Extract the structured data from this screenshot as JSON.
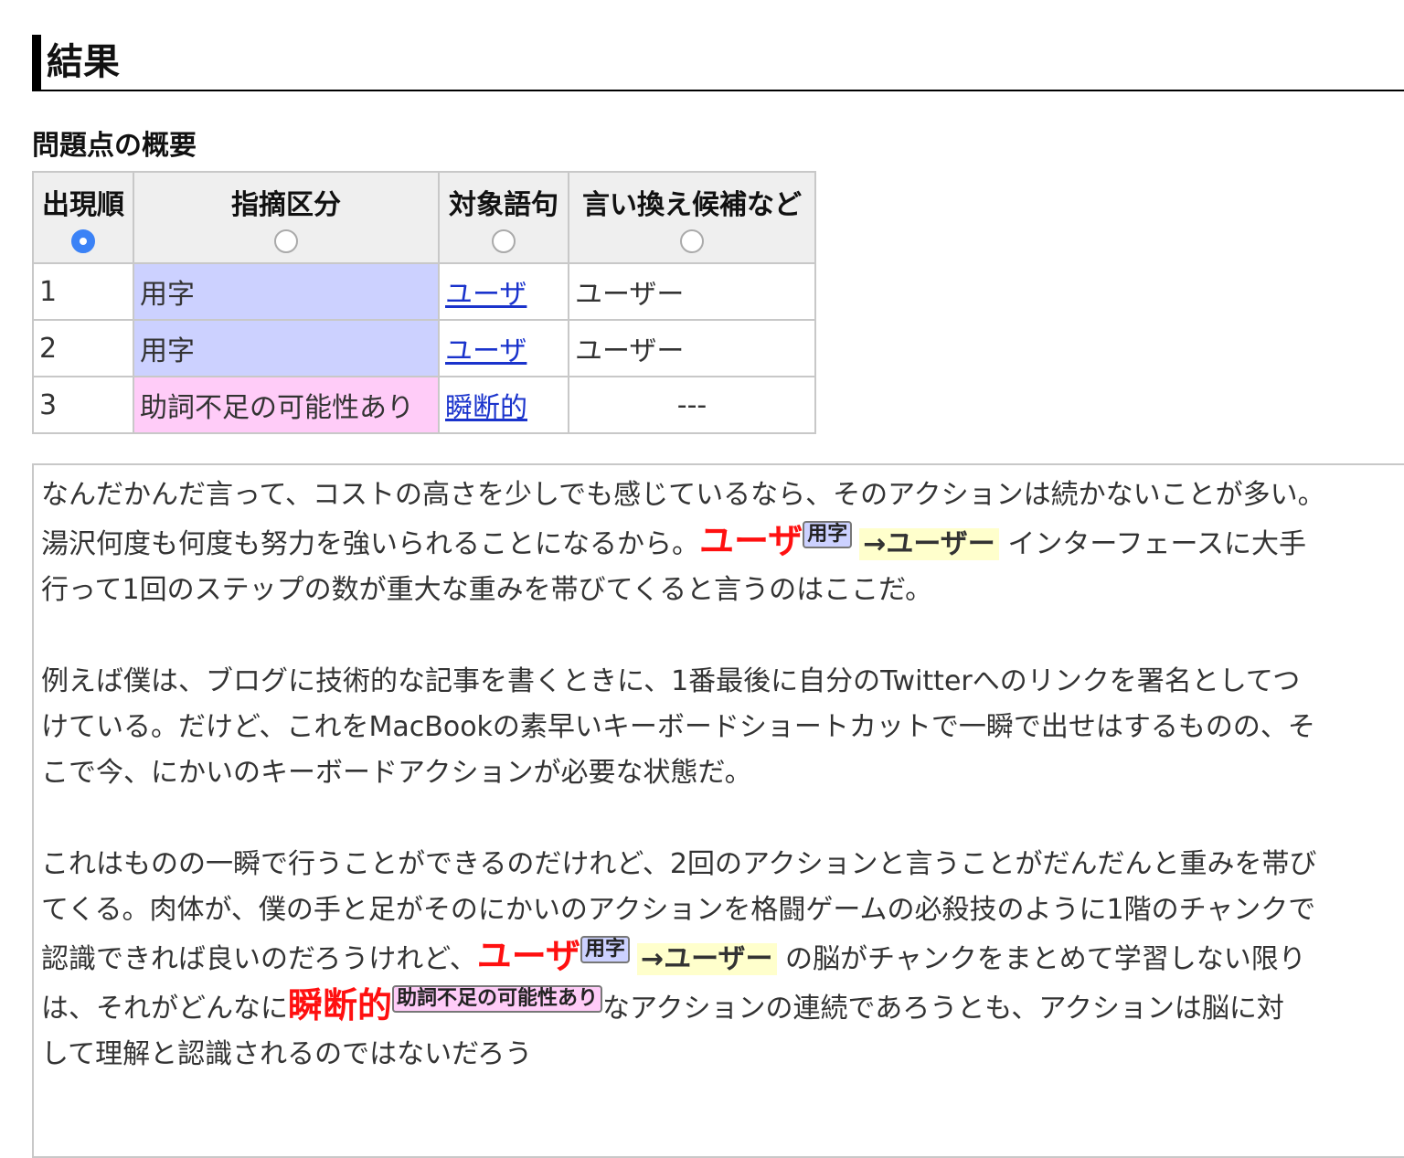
{
  "heading": "結果",
  "summary_title": "問題点の概要",
  "table": {
    "headers": [
      "出現順",
      "指摘区分",
      "対象語句",
      "言い換え候補など"
    ],
    "rows": [
      {
        "order": "1",
        "category": "用字",
        "term": "ユーザ",
        "suggestion": "ユーザー"
      },
      {
        "order": "2",
        "category": "用字",
        "term": "ユーザ",
        "suggestion": "ユーザー"
      },
      {
        "order": "3",
        "category": "助詞不足の可能性あり",
        "term": "瞬断的",
        "suggestion": "---"
      }
    ]
  },
  "text": {
    "p1": {
      "l1": "なんだかんだ言って、コストの高さを少しでも感じているなら、そのアクションは続かないことが多い。",
      "l2a": "湯沢何度も何度も努力を強いられることになるから。",
      "l2_err": "ユーザ",
      "l2_badge": "用字",
      "l2_sugg": "→ユーザー",
      "l2b": " インターフェースに大手",
      "l3": "行って1回のステップの数が重大な重みを帯びてくると言うのはここだ。"
    },
    "p2": {
      "l1": "例えば僕は、ブログに技術的な記事を書くときに、1番最後に自分のTwitterへのリンクを署名としてつ",
      "l2": "けている。だけど、これをMacBookの素早いキーボードショートカットで一瞬で出せはするものの、そ",
      "l3": "こで今、にかいのキーボードアクションが必要な状態だ。"
    },
    "p3": {
      "l1": "これはものの一瞬で行うことができるのだけれど、2回のアクションと言うことがだんだんと重みを帯び",
      "l2": "てくる。肉体が、僕の手と足がそのにかいのアクションを格闘ゲームの必殺技のように1階のチャンクで",
      "l3a": "認識できれば良いのだろうけれど、",
      "l3_err": "ユーザ",
      "l3_badge": "用字",
      "l3_sugg": "→ユーザー",
      "l3b": " の脳がチャンクをまとめて学習しない限り",
      "l4a": "は、それがどんなに",
      "l4_err": "瞬断的",
      "l4_badge": "助詞不足の可能性あり",
      "l4b": "なアクションの連続であろうとも、アクションは脳に対",
      "l5": "して理解と認識されるのではないだろう"
    }
  }
}
